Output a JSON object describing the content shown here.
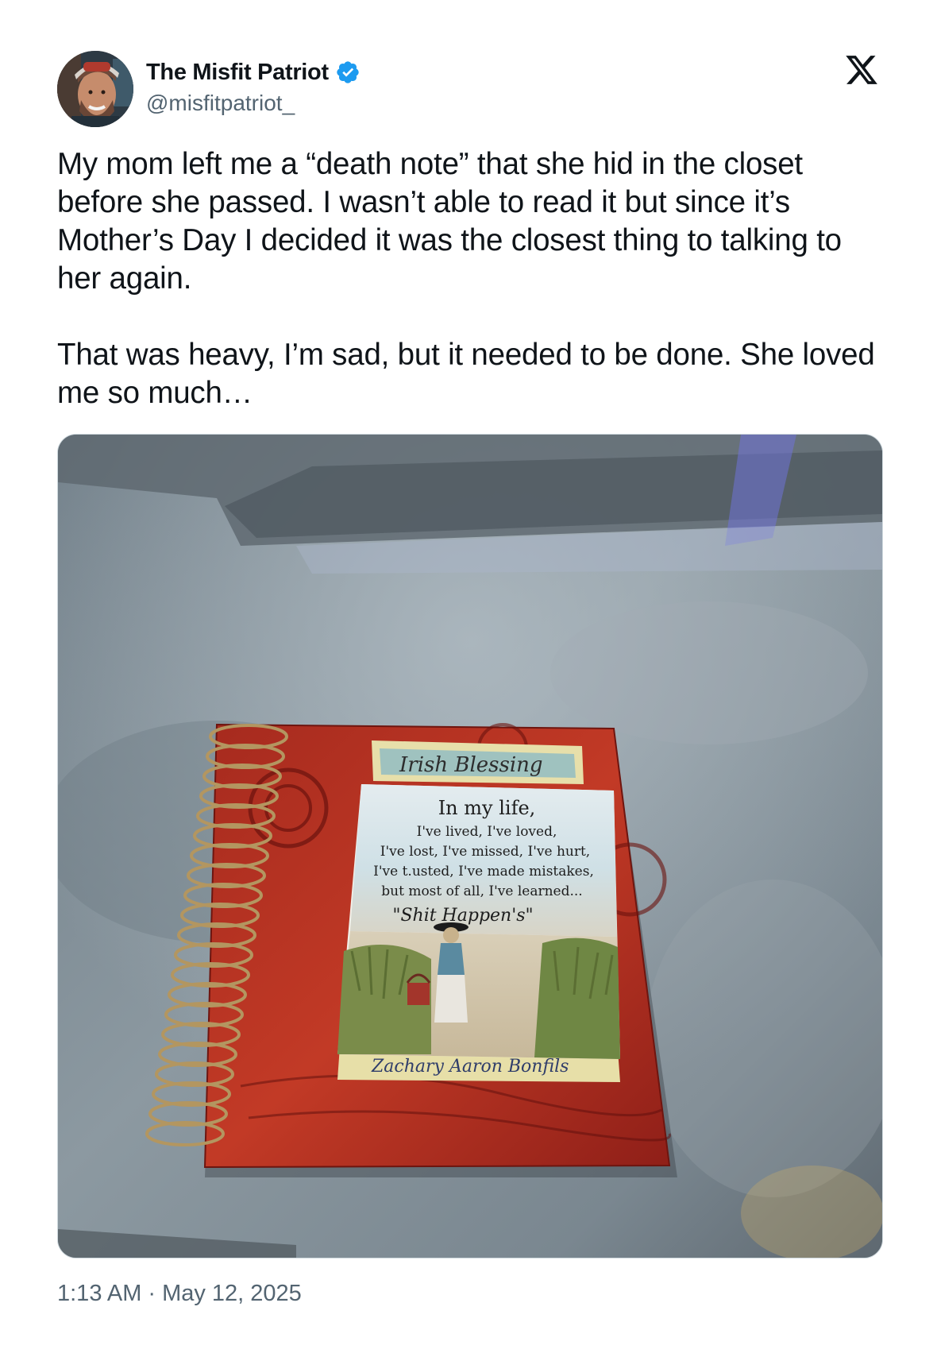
{
  "author": {
    "display_name": "The Misfit Patriot",
    "handle": "@misfitpatriot_",
    "verified": true
  },
  "tweet": {
    "paragraphs": [
      "My mom left me a “death note” that she hid in the closet before she passed. I wasn’t able to read it but since it’s Mother’s Day I decided it was the closest thing to talking to her again.",
      "That was heavy, I’m sad, but it needed to be done. She loved me so much…"
    ],
    "time": "1:13 AM",
    "separator": "·",
    "date": "May 12, 2025"
  },
  "media": {
    "notebook_cover_title": "Irish Blessing",
    "card_lines": [
      "In my life,",
      "I've lived, I've loved,",
      "I've lost, I've missed, I've hurt,",
      "I've t.usted, I've made mistakes,",
      "but most of all, I've learned...",
      "\"Shit Happen's\""
    ],
    "signature": "Zachary Aaron Bonfils"
  },
  "icons": {
    "verified": "verified-badge-icon",
    "brand": "x-logo-icon"
  },
  "colors": {
    "verified_blue": "#1d9bf0",
    "text_primary": "#0f1419",
    "text_secondary": "#536471",
    "notebook_red": "#a8231b"
  }
}
